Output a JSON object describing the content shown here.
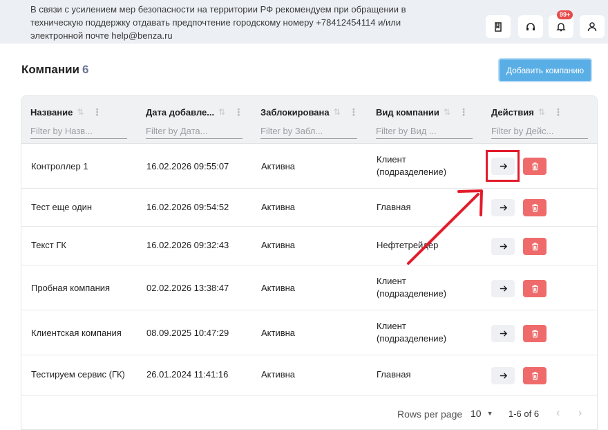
{
  "banner": {
    "notice": "В связи с усилением мер безопасности на территории РФ рекомендуем при обращении в техническую поддержку отдавать предпочтение городскому номеру +78412454114 и/или электронной почте help@benza.ru",
    "buttons": [
      {
        "icon": "book-icon"
      },
      {
        "icon": "headset-icon"
      },
      {
        "icon": "bell-icon",
        "badge": "99+"
      },
      {
        "icon": "user-icon"
      }
    ]
  },
  "page": {
    "title": "Компании",
    "count": "6",
    "add_button": "Добавить компанию"
  },
  "table": {
    "columns": [
      {
        "label": "Название",
        "filter_placeholder": "Filter by Назв..."
      },
      {
        "label": "Дата добавле...",
        "filter_placeholder": "Filter by Дата..."
      },
      {
        "label": "Заблокирована",
        "filter_placeholder": "Filter by Забл..."
      },
      {
        "label": "Вид компании",
        "filter_placeholder": "Filter by Вид ..."
      },
      {
        "label": "Действия",
        "filter_placeholder": "Filter by Дейс..."
      }
    ],
    "rows": [
      {
        "name": "Контроллер 1",
        "date": "16.02.2026 09:55:07",
        "blocked": "Активна",
        "type": "Клиент (подразделение)"
      },
      {
        "name": "Тест еще один",
        "date": "16.02.2026 09:54:52",
        "blocked": "Активна",
        "type": "Главная"
      },
      {
        "name": "Текст ГК",
        "date": "16.02.2026 09:32:43",
        "blocked": "Активна",
        "type": "Нефтетрейдер"
      },
      {
        "name": "Пробная компания",
        "date": "02.02.2026 13:38:47",
        "blocked": "Активна",
        "type": "Клиент (подразделение)"
      },
      {
        "name": "Клиентская компания",
        "date": "08.09.2025 10:47:29",
        "blocked": "Активна",
        "type": "Клиент (подразделение)"
      },
      {
        "name": "Тестируем сервис (ГК)",
        "date": "26.01.2024 11:41:16",
        "blocked": "Активна",
        "type": "Главная"
      }
    ]
  },
  "pagination": {
    "rows_per_page_label": "Rows per page",
    "rows_per_page_value": "10",
    "range": "1-6 of 6"
  },
  "colors": {
    "accent": "#5aaee6",
    "delete": "#ef6b6b",
    "annotation": "#e21b2b"
  }
}
